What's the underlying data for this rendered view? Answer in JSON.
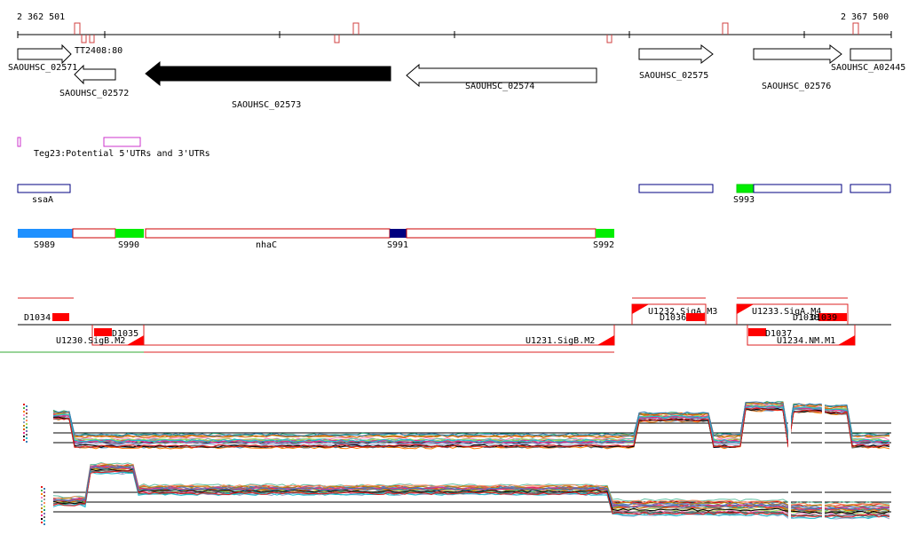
{
  "ruler": {
    "start_label": "2 362 501",
    "end_label": "2 367 500"
  },
  "genes": [
    {
      "label": "SAOUHSC_02571"
    },
    {
      "label": "SAOUHSC_02572"
    },
    {
      "label": "SAOUHSC_02573"
    },
    {
      "label": "SAOUHSC_02574"
    },
    {
      "label": "SAOUHSC_02575"
    },
    {
      "label": "SAOUHSC_02576"
    },
    {
      "label": "SAOUHSC_A02445"
    }
  ],
  "tt_label": "TT2408:80",
  "teg_label": "Teg23:Potential 5'UTRs and 3'UTRs",
  "ssa_label": "ssaA",
  "segments": [
    {
      "label": "S989"
    },
    {
      "label": "S990"
    },
    {
      "label": "nhaC"
    },
    {
      "label": "S991"
    },
    {
      "label": "S992"
    },
    {
      "label": "S993"
    }
  ],
  "features": [
    {
      "label": "D1034"
    },
    {
      "label": "D1035"
    },
    {
      "label": "U1230.SigB.M2"
    },
    {
      "label": "U1231.SigB.M2"
    },
    {
      "label": "U1232.SigA.M3"
    },
    {
      "label": "D1036"
    },
    {
      "label": "U1233.SigA.M4"
    },
    {
      "label": "D1038"
    },
    {
      "label": "D1039"
    },
    {
      "label": "D1037"
    },
    {
      "label": "U1234.NM.M1"
    }
  ],
  "colors": {
    "gene_filled": "#000000",
    "segment_blue": "#1e90ff",
    "segment_green": "#00ee00",
    "segment_navy": "#000080",
    "segment_border": "#cc0000",
    "feature_red": "#ff0000",
    "teg_magenta": "#cc33cc",
    "ssa_navy": "#000080"
  }
}
